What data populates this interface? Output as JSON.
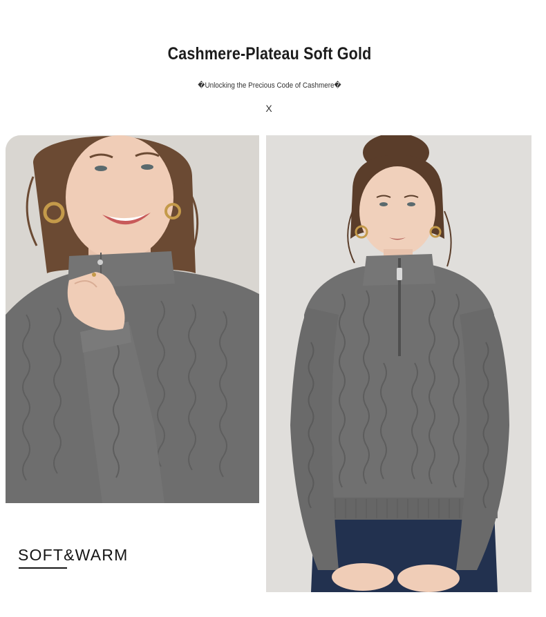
{
  "header": {
    "title": "Cashmere-Plateau Soft Gold",
    "subtitle": "�Unlocking the Precious Code of Cashmere�",
    "separator": "X"
  },
  "photos": {
    "left": "woman-smiling-grey-cable-knit-sweater-closeup",
    "right": "woman-grey-half-zip-cable-knit-sweater-jeans"
  },
  "caption": {
    "text": "SOFT&WARM"
  },
  "colors": {
    "sweater": "#6b6b6b",
    "background": "#ffffff",
    "text": "#1a1a1a"
  }
}
